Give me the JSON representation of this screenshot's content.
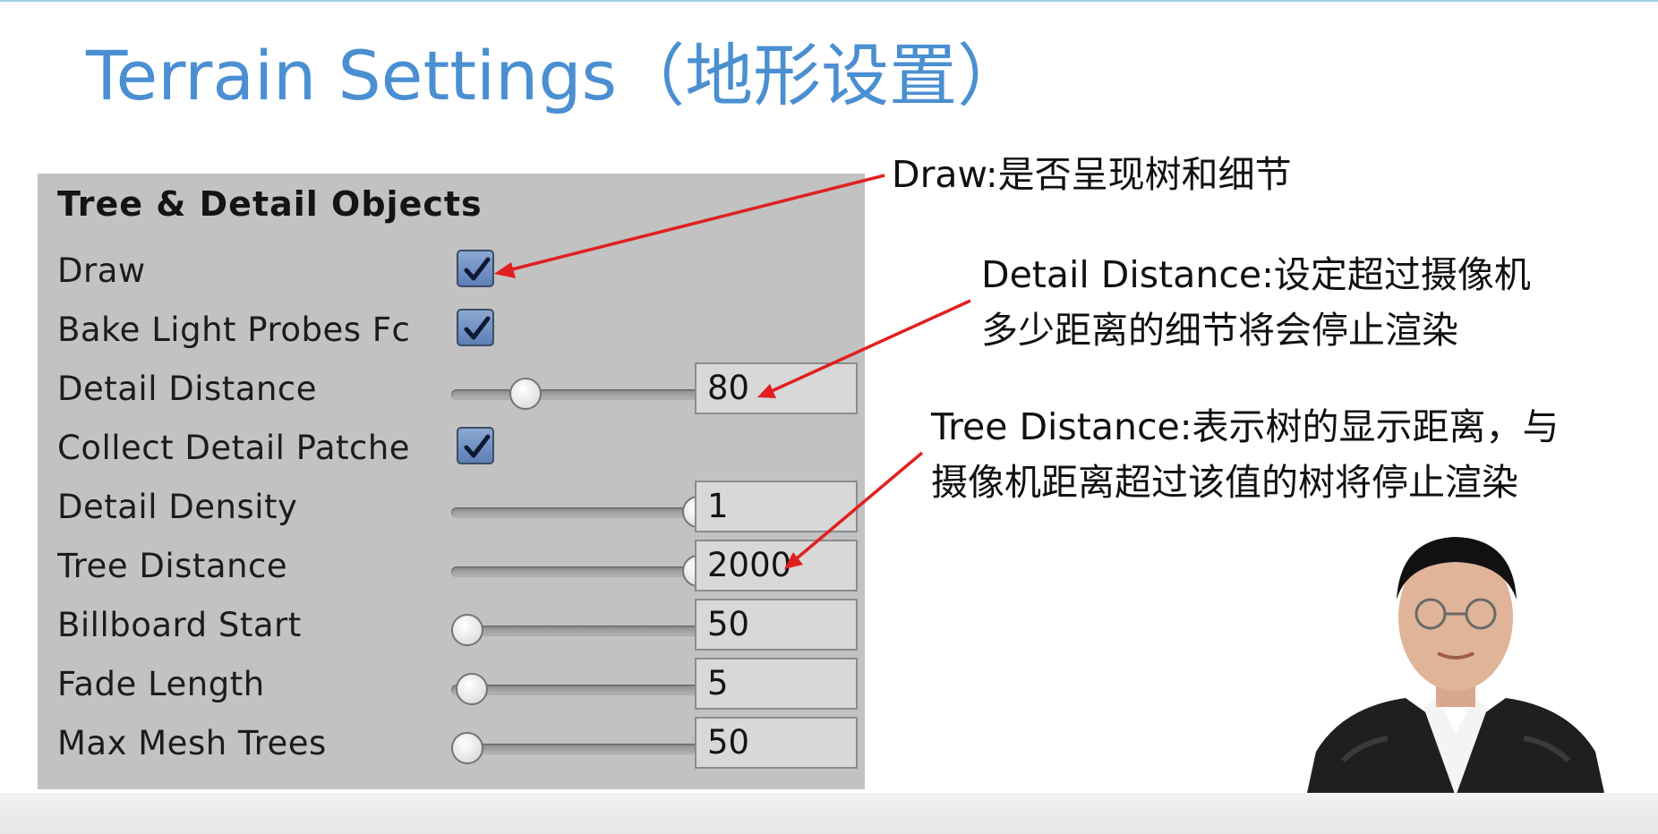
{
  "slide": {
    "title": "Terrain Settings（地形设置）"
  },
  "inspector": {
    "header": "Tree & Detail Objects",
    "rows": [
      {
        "label": "Draw",
        "checked": true
      },
      {
        "label": "Bake Light Probes Fc",
        "checked": true
      },
      {
        "label": "Detail Distance",
        "slider_fraction": 0.25,
        "value": "80"
      },
      {
        "label": "Collect Detail Patche",
        "checked": true
      },
      {
        "label": "Detail Density",
        "slider_fraction": 1.0,
        "value": "1"
      },
      {
        "label": "Tree Distance",
        "slider_fraction": 1.0,
        "value": "2000"
      },
      {
        "label": "Billboard Start",
        "slider_fraction": 0.0,
        "value": "50"
      },
      {
        "label": "Fade Length",
        "slider_fraction": 0.02,
        "value": "5"
      },
      {
        "label": "Max Mesh Trees",
        "slider_fraction": 0.0,
        "value": "50"
      }
    ]
  },
  "annotations": {
    "draw": "Draw:是否呈现树和细节",
    "detail_distance_line1": "Detail Distance:设定超过摄像机",
    "detail_distance_line2": "多少距离的细节将会停止渲染",
    "tree_distance_line1": "Tree Distance:表示树的显示距离，与",
    "tree_distance_line2": "摄像机距离超过该值的树将停止渲染"
  },
  "colors": {
    "title": "#4a8fd1",
    "panel_background": "#c2c2c2",
    "arrow": "#e02020",
    "checkbox": "#6e8ec4"
  },
  "icons": {
    "checkbox": "checkmark",
    "arrow": "red-pointer-arrow"
  }
}
